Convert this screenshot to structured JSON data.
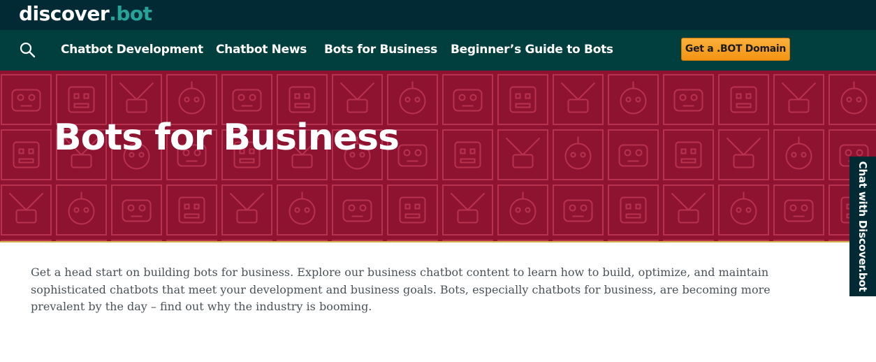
{
  "header": {
    "logo_text": "discover",
    "logo_suffix": ".bot"
  },
  "nav": {
    "search_icon": "search-icon",
    "items": [
      {
        "label": "Chatbot Development"
      },
      {
        "label": "Chatbot News"
      },
      {
        "label": "Bots for Business"
      },
      {
        "label": "Beginner’s Guide to Bots"
      }
    ],
    "cta_label": "Get a .BOT Domain"
  },
  "hero": {
    "title": "Bots for Business"
  },
  "intro": {
    "text": "Get a head start on building bots for business. Explore our business chatbot content to learn how to build, optimize, and maintain sophisticated chatbots that meet your development and business goals. Bots, especially chatbots for business, are becoming more prevalent by the day – find out why the industry is booming."
  },
  "chat_widget": {
    "label": "Chat with Discover.bot"
  },
  "colors": {
    "topbar": "#022a35",
    "navbar": "#003f3d",
    "hero": "#8e1331",
    "accent": "#f39313",
    "logo_accent": "#25a59a"
  }
}
